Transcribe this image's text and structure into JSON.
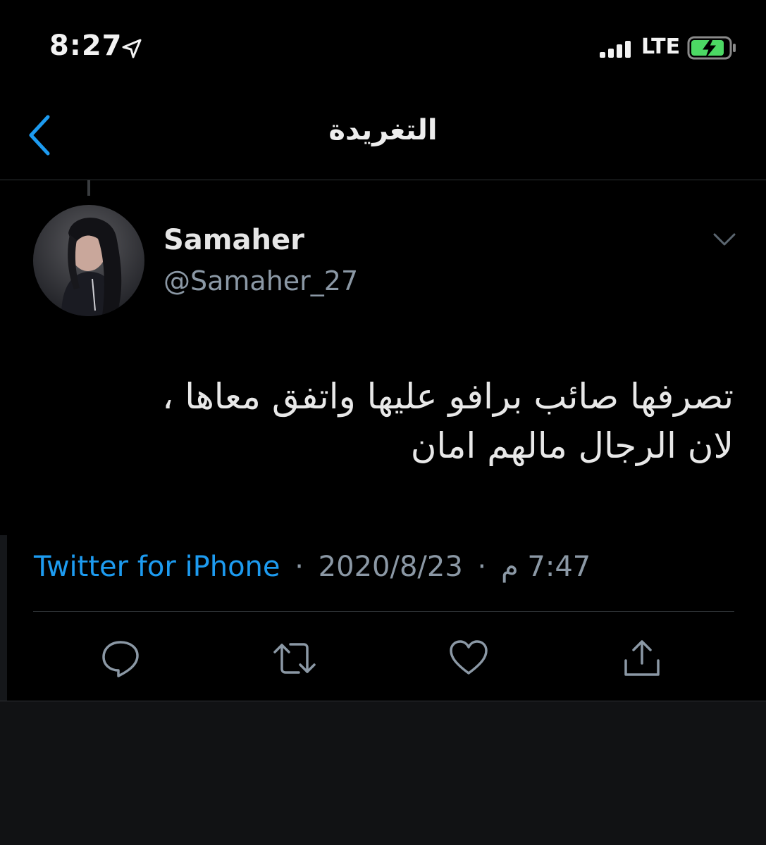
{
  "status_bar": {
    "time": "8:27",
    "network": "LTE",
    "battery_color": "#4cd964"
  },
  "nav": {
    "title": "التغريدة",
    "accent_color": "#1d9bf0"
  },
  "tweet": {
    "author_name": "Samaher",
    "author_handle": "@Samaher_27",
    "text_lines": [
      "تصرفها صائب برافو عليها واتفق معاها ،",
      "لان الرجال مالهم امان"
    ],
    "time": "7:47 م",
    "date": "2020/8/23",
    "source": "Twitter for iPhone",
    "separator": "·"
  },
  "icons": {
    "back": "chevron-left-icon",
    "more": "chevron-down-icon",
    "location": "location-arrow-icon",
    "reply": "reply-icon",
    "retweet": "retweet-icon",
    "like": "heart-icon",
    "share": "share-icon"
  }
}
